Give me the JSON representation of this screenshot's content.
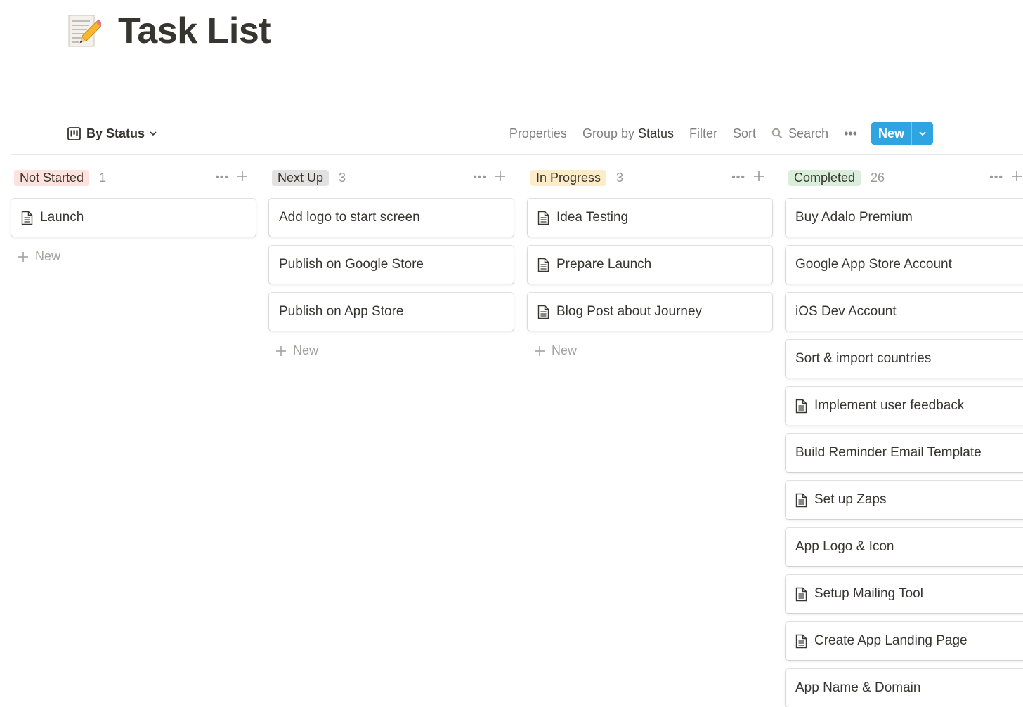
{
  "page": {
    "title": "Task List",
    "icon": "memo-pencil-icon"
  },
  "view": {
    "label": "By Status",
    "icon": "board-view-icon"
  },
  "toolbar": {
    "properties": "Properties",
    "group_by": "Group by",
    "group_by_value": "Status",
    "filter": "Filter",
    "sort": "Sort",
    "search": "Search",
    "more": "•••",
    "new": "New"
  },
  "colors": {
    "accent": "#2ea5e1",
    "not_started": "#ffe2dd",
    "next_up": "#e3e2e0",
    "in_progress": "#fdecc8",
    "completed": "#dbeddb"
  },
  "new_label": "New",
  "columns": [
    {
      "status": "Not Started",
      "count": "1",
      "color": "#ffe2dd",
      "cards": [
        {
          "title": "Launch",
          "icon": true
        }
      ]
    },
    {
      "status": "Next Up",
      "count": "3",
      "color": "#e3e2e0",
      "cards": [
        {
          "title": "Add logo to start screen",
          "icon": false
        },
        {
          "title": "Publish on Google Store",
          "icon": false
        },
        {
          "title": "Publish on App Store",
          "icon": false
        }
      ]
    },
    {
      "status": "In Progress",
      "count": "3",
      "color": "#fdecc8",
      "cards": [
        {
          "title": "Idea Testing",
          "icon": true
        },
        {
          "title": "Prepare Launch",
          "icon": true
        },
        {
          "title": "Blog Post about Journey",
          "icon": true
        }
      ]
    },
    {
      "status": "Completed",
      "count": "26",
      "color": "#dbeddb",
      "cards": [
        {
          "title": "Buy Adalo Premium",
          "icon": false
        },
        {
          "title": "Google App Store Account",
          "icon": false
        },
        {
          "title": "iOS Dev Account",
          "icon": false
        },
        {
          "title": "Sort & import countries",
          "icon": false
        },
        {
          "title": "Implement user feedback",
          "icon": true
        },
        {
          "title": "Build Reminder Email Template",
          "icon": false
        },
        {
          "title": "Set up Zaps",
          "icon": true
        },
        {
          "title": "App Logo & Icon",
          "icon": false
        },
        {
          "title": "Setup Mailing Tool",
          "icon": true
        },
        {
          "title": "Create App Landing Page",
          "icon": true
        },
        {
          "title": "App Name & Domain",
          "icon": false
        }
      ]
    }
  ]
}
